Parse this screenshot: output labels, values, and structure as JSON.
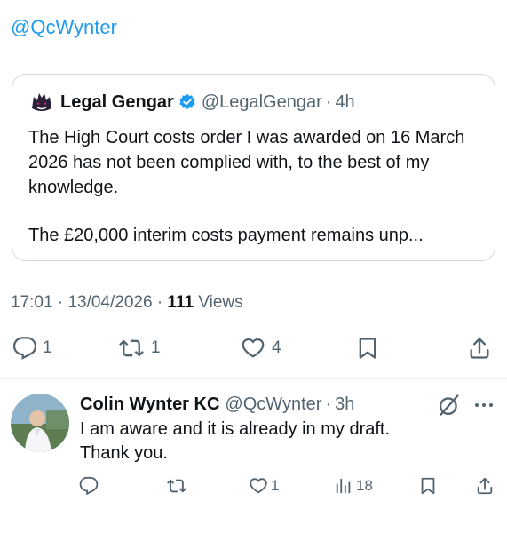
{
  "reply_context": {
    "handle": "@QcWynter"
  },
  "quote": {
    "name": "Legal Gengar",
    "handle": "@LegalGengar",
    "sep": "·",
    "age": "4h",
    "paragraph1": "The High Court costs order I was awarded on 16 March 2026 has not been complied with, to the best of my knowledge.",
    "paragraph2": "The £20,000 interim costs payment remains unp..."
  },
  "meta": {
    "time": "17:01",
    "sep1": "·",
    "date": "13/04/2026",
    "sep2": "·",
    "views_count": "111",
    "views_label": "Views"
  },
  "actions": {
    "replies": "1",
    "reposts": "1",
    "likes": "4"
  },
  "reply": {
    "name": "Colin Wynter KC",
    "handle": "@QcWynter",
    "sep": "·",
    "age": "3h",
    "line1": "I am aware and it is already in my draft.",
    "line2": "Thank you.",
    "likes": "1",
    "views": "18"
  },
  "colors": {
    "accent": "#1d9bf0",
    "muted": "#536471",
    "text": "#0f1419",
    "border": "#cfd9de"
  },
  "icons": [
    "reply-icon",
    "repost-icon",
    "like-icon",
    "bookmark-icon",
    "share-icon",
    "verified-icon",
    "grok-icon",
    "more-icon",
    "views-icon"
  ]
}
